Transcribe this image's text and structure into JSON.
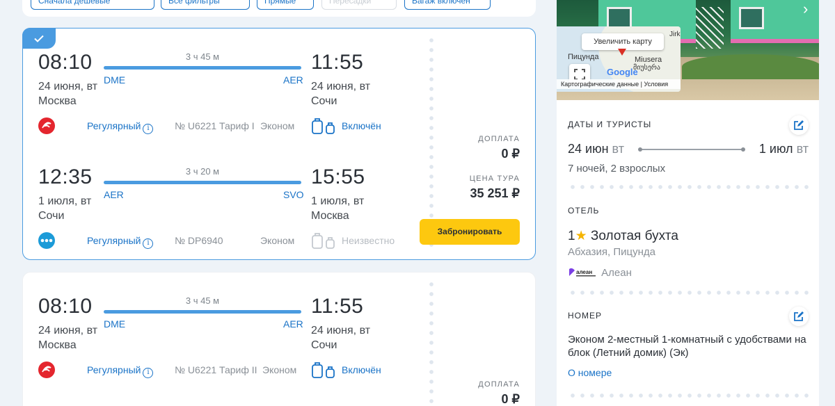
{
  "filters": [
    "Сначала дешевые",
    "Все фильтры",
    "Прямые",
    "Пересадки",
    "Багаж включен"
  ],
  "colors": {
    "accent": "#4a9be0",
    "link": "#1a73c7",
    "cta": "#fdc80f"
  },
  "cards": [
    {
      "selected": true,
      "segments": [
        {
          "dep_time": "08:10",
          "dep_date": "24 июня, вт",
          "dep_city": "Москва",
          "dep_code": "DME",
          "arr_time": "11:55",
          "arr_date": "24 июня, вт",
          "arr_city": "Сочи",
          "arr_code": "AER",
          "duration": "3 ч 45 м",
          "airline_logo": "red-globus-logo",
          "type": "Регулярный",
          "flight": "№ U6221 Тариф I",
          "class": "Эконом",
          "baggage": "Включён",
          "baggage_known": true
        },
        {
          "dep_time": "12:35",
          "dep_date": "1 июля, вт",
          "dep_city": "Сочи",
          "dep_code": "AER",
          "arr_time": "15:55",
          "arr_date": "1 июля, вт",
          "arr_city": "Москва",
          "arr_code": "SVO",
          "duration": "3 ч 20 м",
          "airline_logo": "blue-dots-logo",
          "type": "Регулярный",
          "flight": "№ DP6940",
          "class": "Эконом",
          "baggage": "Неизвестно",
          "baggage_known": false
        }
      ],
      "extra_label": "Доплата",
      "extra_value": "0 ₽",
      "tour_label": "Цена тура",
      "tour_value": "35 251 ₽",
      "book_label": "Забронировать"
    },
    {
      "selected": false,
      "segments": [
        {
          "dep_time": "08:10",
          "dep_date": "24 июня, вт",
          "dep_city": "Москва",
          "dep_code": "DME",
          "arr_time": "11:55",
          "arr_date": "24 июня, вт",
          "arr_city": "Сочи",
          "arr_code": "AER",
          "duration": "3 ч 45 м",
          "airline_logo": "red-globus-logo",
          "type": "Регулярный",
          "flight": "№ U6221 Тариф II",
          "class": "Эконом",
          "baggage": "Включён",
          "baggage_known": true
        }
      ],
      "extra_label": "Доплата",
      "extra_value": "0 ₽"
    }
  ],
  "sidebar": {
    "map": {
      "enlarge_label": "Увеличить карту",
      "places": [
        "Пицунда",
        "Miusera",
        "მიუსერა",
        "Jirk"
      ],
      "google": "Google",
      "attribution": "Картографические данные",
      "terms": "Условия"
    },
    "dates": {
      "title": "Даты и туристы",
      "from": "24 июн",
      "from_dow": "вт",
      "to": "1 июл",
      "to_dow": "вт",
      "summary": "7 ночей, 2 взрослых"
    },
    "hotel": {
      "title": "Отель",
      "stars": "1",
      "name": "Золотая бухта",
      "location": "Абхазия, Пицунда",
      "operator_logo": "алеан",
      "operator": "Алеан"
    },
    "room": {
      "title": "Номер",
      "description": "Эконом 2-местный 1-комнатный с удобствами на блок (Летний домик) (Эк)",
      "link": "О номере"
    }
  }
}
